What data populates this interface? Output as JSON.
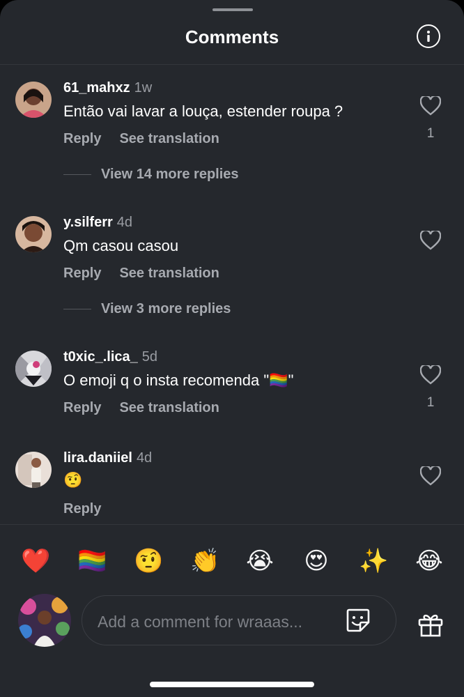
{
  "header": {
    "title": "Comments",
    "info_icon": "info-icon"
  },
  "comments": [
    {
      "username": "61_mahxz",
      "time": "1w",
      "text": "Então vai lavar a louça, estender roupa ?",
      "reply_label": "Reply",
      "translate_label": "See translation",
      "likes": "1",
      "view_more": "View 14 more replies"
    },
    {
      "username": "y.silferr",
      "time": "4d",
      "text": "Qm casou casou",
      "reply_label": "Reply",
      "translate_label": "See translation",
      "view_more": "View 3 more replies"
    },
    {
      "username": "t0xic_.lica_",
      "time": "5d",
      "text": "O emoji q o insta recomenda \"🏳️‍🌈\"",
      "reply_label": "Reply",
      "translate_label": "See translation",
      "likes": "1"
    },
    {
      "username": "lira.daniiel",
      "time": "4d",
      "text": "🤨",
      "reply_label": "Reply"
    }
  ],
  "emoji_bar": [
    "❤️",
    "🏳️‍🌈",
    "🤨",
    "👏",
    "😭",
    "😍",
    "✨",
    "😂"
  ],
  "composer": {
    "placeholder": "Add a comment for wraaas...",
    "sticker_icon": "sticker-icon",
    "gift_icon": "gift-icon"
  },
  "colors": {
    "background": "#25282d",
    "muted_text": "#a7aab0",
    "divider": "#33363b"
  }
}
